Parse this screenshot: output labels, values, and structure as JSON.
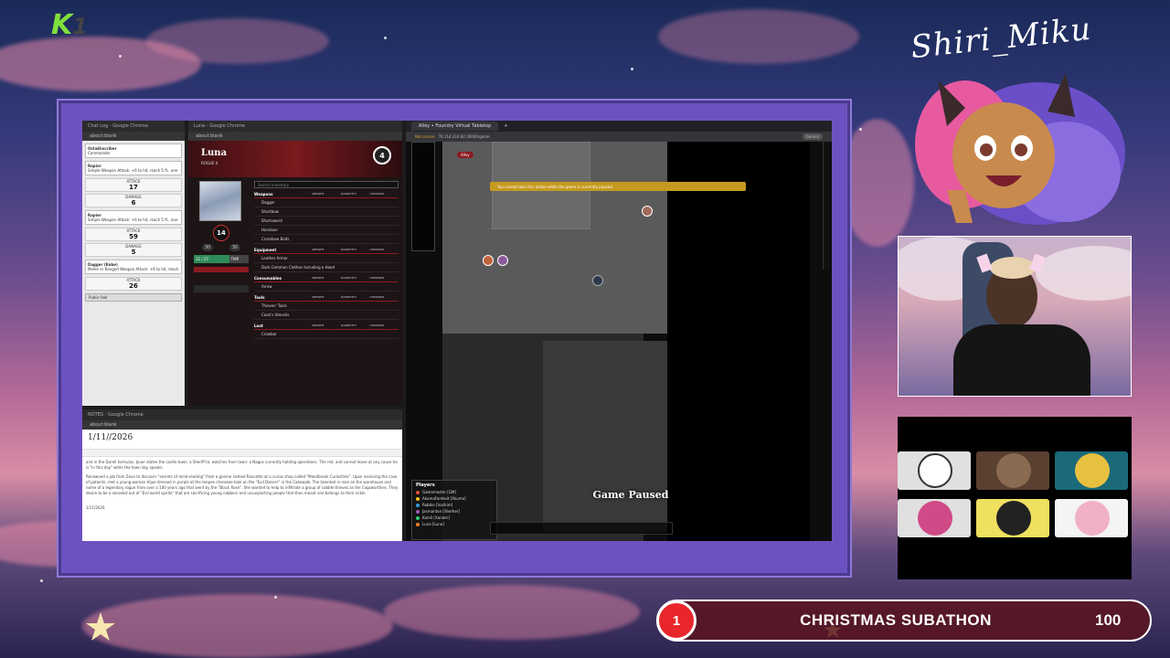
{
  "overlay": {
    "logo": {
      "k": "K",
      "num": "1"
    },
    "streamer_name": "Shiri_Miku",
    "subathon": {
      "rank": "1",
      "title": "CHRISTMAS SUBATHON",
      "value": "100"
    },
    "colors": {
      "accent": "#6c52c0",
      "bar_red": "#e8262c",
      "logo_green": "#7fe03c"
    }
  },
  "windows": {
    "chat_log": {
      "title": "Chat Log - Google Chrome",
      "address": "about:blank",
      "cards": [
        {
          "name": "Ostakhscriber",
          "sub": "Commander"
        },
        {
          "name": "Rapier",
          "desc": "Simple Weapon Attack: +6 to hit, reach 5 ft., one target. 1d8 +4 piercing damage."
        },
        {
          "label": "ATTACK",
          "value": "17"
        },
        {
          "label": "DAMAGE",
          "value": "6"
        },
        {
          "name": "Rapier",
          "desc": "Simple Weapon Attack: +6 to hit, reach 5 ft., one target."
        },
        {
          "label": "ATTACK",
          "value": "59"
        },
        {
          "label": "DAMAGE",
          "value": "5"
        },
        {
          "name": "Dagger (Kobe)",
          "desc": "Melee or Ranged Weapon Attack: +6 to hit, reach 5 ft., one target."
        },
        {
          "label": "ATTACK",
          "value": "26"
        }
      ],
      "footer": "Public Roll"
    },
    "luna": {
      "title": "Luna - Google Chrome",
      "address": "about:blank",
      "character": "Luna",
      "class": "ROGUE 4",
      "level": "4",
      "ac": "14",
      "hp": "30",
      "hp_max": "30",
      "hit_dice": "12 / 27",
      "temp": "TMP",
      "search_placeholder": "Search Inventory",
      "sections": [
        {
          "name": "Weapons",
          "items": [
            "Dagger",
            "Shortbow",
            "Shortsword",
            "Handaxe",
            "Crossbow Bolts"
          ]
        },
        {
          "name": "Equipment",
          "items": [
            "Leather Armor",
            "Dark Common Clothes Including a Hood"
          ]
        },
        {
          "name": "Consumables",
          "items": [
            "Arrow"
          ]
        },
        {
          "name": "Tools",
          "items": [
            "Thieves' Tools",
            "Cook's Utensils"
          ]
        },
        {
          "name": "Loot",
          "items": [
            "Crowbar"
          ]
        }
      ],
      "columns": [
        "WEIGHT",
        "QUANTITY",
        "CHARGES"
      ]
    },
    "notes": {
      "title": "NOTES - Google Chrome",
      "address": "about:blank",
      "date": "1/11//2026",
      "text1": "and in the Durell formulas. Jouer states the castle town, a Sheriff to, watches from town: a Nagos currently holding operations. The red, and cannot leave at any cause he is \"in this day\" while the town day speaks.",
      "text2": "Renowned a job from Zeon to discover \"secrets of mind-reading\" from a gnome named Rancetto at a curios shop called \"Mendbrook Curiosities\". Upon receiving the case of patients, met a young woman Hijue dressed in purple at the teepee cherokee-look on the \"Evil Dancer\" in the Cakewalk. The talented in rose on the warehouse and name of a legendary rogue from over a 100 years ago that went by the \"Black Rose\". She wanted to help to infiltrate a group of cobble thieves as the Cogsworthies. They desire to be a seceded out of \"Evil world spirits\" that are sacrificing young nabbers and unsuspecting people that then meant one belongs to their rickle.",
      "footer_date": "1/11/2026"
    },
    "foundry": {
      "tab": "Alley • Foundry Virtual Tabletop",
      "new_tab": "+",
      "address": "76.114.216.82:30000/game",
      "secure": "Not secure",
      "gemini": "Gemini",
      "banner": "You cannot take this action while the game is currently paused.",
      "paused": "Game Paused",
      "scene": "Alley",
      "players_title": "Players",
      "players": [
        {
          "name": "Gamemaster [GM]",
          "color": "#e74c3c"
        },
        {
          "name": "AkumaFamkeit [Akuma]",
          "color": "#f1c40f"
        },
        {
          "name": "Robbie [Ina/him]",
          "color": "#3498db"
        },
        {
          "name": "Jasmantan [She/her]",
          "color": "#9b59b6"
        },
        {
          "name": "Kamil [Xander]",
          "color": "#2ecc71"
        },
        {
          "name": "Luna [Luna]",
          "color": "#e67e22"
        }
      ]
    }
  }
}
